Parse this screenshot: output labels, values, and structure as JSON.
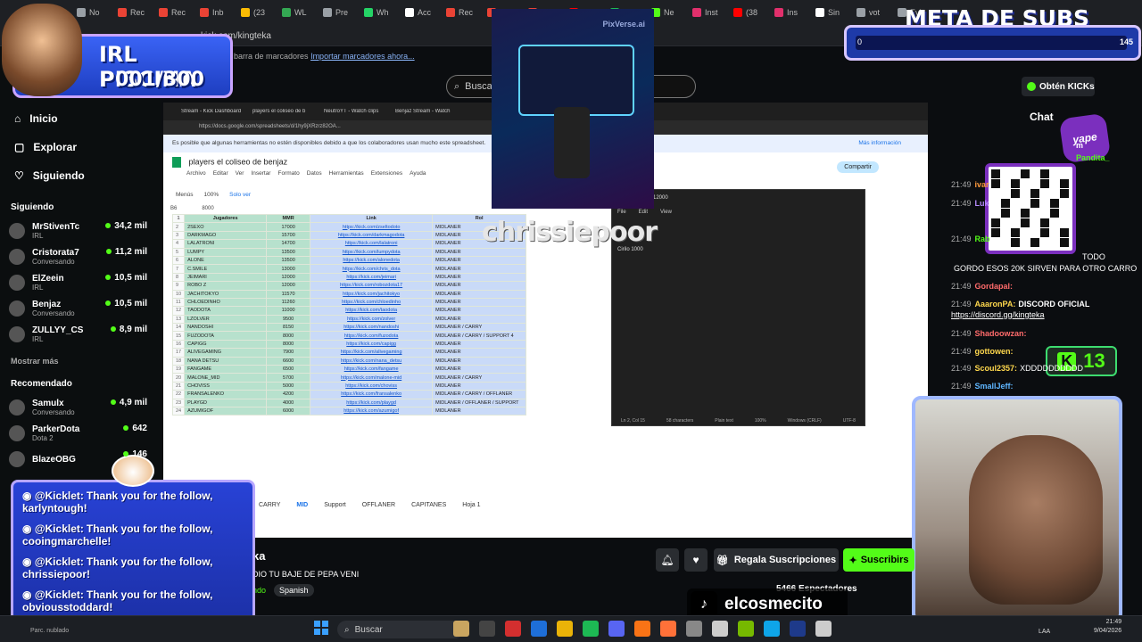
{
  "browser": {
    "tabs": [
      "Hi",
      "No",
      "Rec",
      "Rec",
      "Inb",
      "(23",
      "WL",
      "Pre",
      "Wh",
      "Acc",
      "Rec",
      "Inb",
      "Rel",
      "Yo",
      "Sp",
      "Ne",
      "Inst",
      "(38",
      "Ins",
      "Sin",
      "vot",
      "Evi"
    ],
    "url": "kick.com/kingteka",
    "bookmarks_text": "barra de marcadores",
    "bookmarks_link": "Importar marcadores ahora..."
  },
  "nav": {
    "home": "Inicio",
    "explore": "Explorar",
    "following": "Siguiendo",
    "section_following": "Siguiendo",
    "show_more": "Mostrar más",
    "section_recommended": "Recomendado",
    "following_channels": [
      {
        "name": "MrStivenTc",
        "sub": "IRL",
        "viewers": "34,2 mil"
      },
      {
        "name": "Cristorata7",
        "sub": "Conversando",
        "viewers": "11,2 mil"
      },
      {
        "name": "ElZeein",
        "sub": "IRL",
        "viewers": "10,5 mil"
      },
      {
        "name": "Benjaz",
        "sub": "Conversando",
        "viewers": "10,5 mil"
      },
      {
        "name": "ZULLYY_CS",
        "sub": "IRL",
        "viewers": "8,9 mil"
      }
    ],
    "recommended_channels": [
      {
        "name": "Samulx",
        "sub": "Conversando",
        "viewers": "4,9 mil"
      },
      {
        "name": "ParkerDota",
        "sub": "Dota 2",
        "viewers": "642"
      },
      {
        "name": "BlazeOBG",
        "sub": "",
        "viewers": "146"
      }
    ]
  },
  "search": {
    "placeholder": "Buscar"
  },
  "overlay": {
    "piscina_title": "IRL PISCINA",
    "piscina_count": "001/300",
    "meta_title": "META DE SUBS",
    "meta_current": "0",
    "meta_goal": "145",
    "pixverse": "PixVerse.ai",
    "chrissie": "chrissiepoor",
    "tiktok_handle": "elcosmecito",
    "k_count": "13",
    "yape_label": "yape"
  },
  "sheet": {
    "doc_title": "players el coliseo de benjaz",
    "menu": [
      "Archivo",
      "Editar",
      "Ver",
      "Insertar",
      "Formato",
      "Datos",
      "Herramientas",
      "Extensiones",
      "Ayuda"
    ],
    "warning": "Es posible que algunas herramientas no estén disponibles debido a que los colaboradores usan mucho este spreadsheet.",
    "warning_link": "Más información",
    "share": "Compartir",
    "view_only": "Solo ver",
    "menus": "Menús",
    "zoom": "100%",
    "cell_ref": "B6",
    "cell_value": "8000",
    "headers": [
      "Jugadores",
      "MMR",
      "Link",
      "Rol"
    ],
    "rows": [
      [
        "2SEXO",
        "17000",
        "https://kick.com/zseltodoto",
        "MIDLANER"
      ],
      [
        "DARKMAGO",
        "15700",
        "https://kick.com/darkmagodota",
        "MIDLANER"
      ],
      [
        "LALATRONI",
        "14700",
        "https://kick.com/lalatroni",
        "MIDLANER"
      ],
      [
        "LUMPY",
        "13500",
        "https://kick.com/lumpydota",
        "MIDLANER"
      ],
      [
        "ALONE",
        "13500",
        "https://kick.com/alonedota",
        "MIDLANER"
      ],
      [
        "C.SMILE",
        "13000",
        "https://kick.com/chris_dota",
        "MIDLANER"
      ],
      [
        "JEIMARI",
        "12000",
        "https://kick.com/jeimari",
        "MIDLANER"
      ],
      [
        "ROBO Z",
        "12000",
        "https://kick.com/robozdota17",
        "MIDLANER"
      ],
      [
        "JACHITOKYO",
        "11570",
        "https://kick.com/jachitokyo",
        "MIDLANER"
      ],
      [
        "CHLOEDINHO",
        "11260",
        "https://kick.com/chloedinho",
        "MIDLANER"
      ],
      [
        "TAODOTA",
        "11000",
        "https://kick.com/taodota",
        "MIDLANER"
      ],
      [
        "LZOLVER",
        "9500",
        "https://kick.com/zolver",
        "MIDLANER"
      ],
      [
        "NANDOSHI",
        "8150",
        "https://kick.com/nandoshi",
        "MIDLANER / CARRY"
      ],
      [
        "FUZODOTA",
        "8000",
        "https://kick.com/fuzodota",
        "MIDLANER / CARRY / SUPPORT 4"
      ],
      [
        "CAPIGG",
        "8000",
        "https://kick.com/capigg",
        "MIDLANER"
      ],
      [
        "ALIVEGAMING",
        "7900",
        "https://kick.com/alivegaming",
        "MIDLANER"
      ],
      [
        "NANA DETSU",
        "6600",
        "https://kick.com/nana_detsu",
        "MIDLANER"
      ],
      [
        "FANGAME",
        "6500",
        "https://kick.com/fangame",
        "MIDLANER"
      ],
      [
        "MALONE_MID",
        "5700",
        "https://kick.com/malone-mid",
        "MIDLANER / CARRY"
      ],
      [
        "CHOVISS",
        "5000",
        "https://kick.com/choviss",
        "MIDLANER"
      ],
      [
        "FRANSALENKO",
        "4200",
        "https://kick.com/fransalenko",
        "MIDLANER / CARRY / OFFLANER"
      ],
      [
        "PLAYGD",
        "4000",
        "https://kick.com/playgd",
        "MIDLANER / OFFLANER / SUPPORT"
      ],
      [
        "AZUMIGOF",
        "6000",
        "https://kick.com/azumigof",
        "MIDLANER"
      ]
    ],
    "sheet_tabs": [
      "CARRY",
      "MID",
      "Support",
      "OFFLANER",
      "CAPITANES",
      "Hoja 1"
    ],
    "active_tab": "MID"
  },
  "notepad": {
    "title": "12000",
    "menu": [
      "File",
      "Edit",
      "View"
    ],
    "content": "Cirilo  1000",
    "status": [
      "Ln 2, Col 15",
      "58 characters",
      "Plain text",
      "100%",
      "Windows (CRLF)",
      "UTF-8"
    ]
  },
  "channel": {
    "name": "ka",
    "subtitle": "DIO TU BAJE DE PEPA VENI",
    "category_prefix": "ndo",
    "language": "Spanish",
    "gift_button": "Regala Suscripciones",
    "subscribe_button": "Suscribirs",
    "viewers": "5466 Espectadores"
  },
  "chat": {
    "kicks_button": "Obtén KICKs",
    "title": "Chat",
    "messages": [
      {
        "time": "",
        "user": "m",
        "text": ""
      },
      {
        "time": "",
        "user": "Pandita_",
        "text": ""
      },
      {
        "time": "21:49",
        "user": "ivar",
        "text": ""
      },
      {
        "time": "21:49",
        "user": "Luk",
        "text": ""
      },
      {
        "time": "21:49",
        "user": "Rab",
        "text": ""
      },
      {
        "time": "",
        "user": "",
        "text": "TODO"
      },
      {
        "time": "",
        "user": "",
        "text": "GORDO ESOS 20K SIRVEN PARA OTRO CARRO"
      },
      {
        "time": "21:49",
        "user": "Gordapal:",
        "text": ""
      },
      {
        "time": "21:49",
        "user": "AaaronPA:",
        "text": "DISCORD OFICIAL"
      },
      {
        "time": "",
        "user": "",
        "text": "https://discord.gg/kingteka"
      },
      {
        "time": "21:49",
        "user": "Shadoowzan:",
        "text": ""
      },
      {
        "time": "21:49",
        "user": "gottowen:",
        "text": ""
      },
      {
        "time": "21:49",
        "user": "Scoul2357:",
        "text": "XDDDDDDDDDD"
      },
      {
        "time": "21:49",
        "user": "SmallJeff:",
        "text": ""
      }
    ]
  },
  "alerts": [
    {
      "prefix": "@Kicklet:",
      "text": "Thank you for the follow,",
      "who": "karlyntough!"
    },
    {
      "prefix": "@Kicklet:",
      "text": "Thank you for the follow,",
      "who": "cooingmarchelle!"
    },
    {
      "prefix": "@Kicklet:",
      "text": "Thank you for the follow,",
      "who": "chrissiepoor!"
    },
    {
      "prefix": "@Kicklet:",
      "text": "Thank you for the follow,",
      "who": "obviousstoddard!"
    }
  ],
  "taskbar": {
    "search_placeholder": "Buscar",
    "weather": "Parc. nublado",
    "lang": "LAA",
    "time": "21:49",
    "date": "9/04/2026"
  },
  "colors": {
    "kick_green": "#53fc18",
    "panel_blue": "#1e3aa8",
    "accent_purple": "#7b2fbe"
  }
}
